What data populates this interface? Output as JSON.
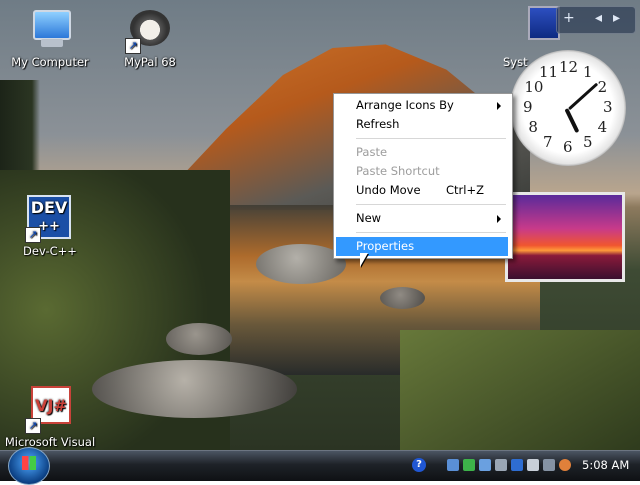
{
  "desktop": {
    "icons": [
      {
        "label": "My Computer"
      },
      {
        "label": "MyPal 68"
      },
      {
        "label": "Dev-C++",
        "badge_top": "DEV",
        "badge_bottom": "++"
      },
      {
        "label": "Microsoft Visual",
        "badge": "VJ#"
      }
    ],
    "gadget_label": "Syst"
  },
  "context_menu": {
    "items": [
      {
        "label": "Arrange Icons By",
        "state": "normal",
        "submenu": true
      },
      {
        "label": "Refresh",
        "state": "normal"
      },
      {
        "label": "Paste",
        "state": "disabled"
      },
      {
        "label": "Paste Shortcut",
        "state": "disabled"
      },
      {
        "label": "Undo Move",
        "shortcut": "Ctrl+Z",
        "state": "normal"
      },
      {
        "label": "New",
        "state": "normal",
        "submenu": true
      },
      {
        "label": "Properties",
        "state": "selected"
      }
    ]
  },
  "gadgets": {
    "toolbar": {
      "add": "+",
      "prev": "◂",
      "next": "▸"
    },
    "clock": {
      "numbers": [
        "12",
        "1",
        "2",
        "3",
        "4",
        "5",
        "6",
        "7",
        "8",
        "9",
        "10",
        "11"
      ],
      "hour": 5,
      "minute": 8
    }
  },
  "taskbar": {
    "time": "5:08 AM",
    "help_glyph": "?",
    "tray_icons": [
      "network-icon",
      "antivirus-icon",
      "volume-icon",
      "keyboard-icon",
      "language-icon",
      "search-tray-icon"
    ]
  },
  "colors": {
    "menu_highlight": "#3399ff",
    "taskbar": "#1e2228"
  }
}
